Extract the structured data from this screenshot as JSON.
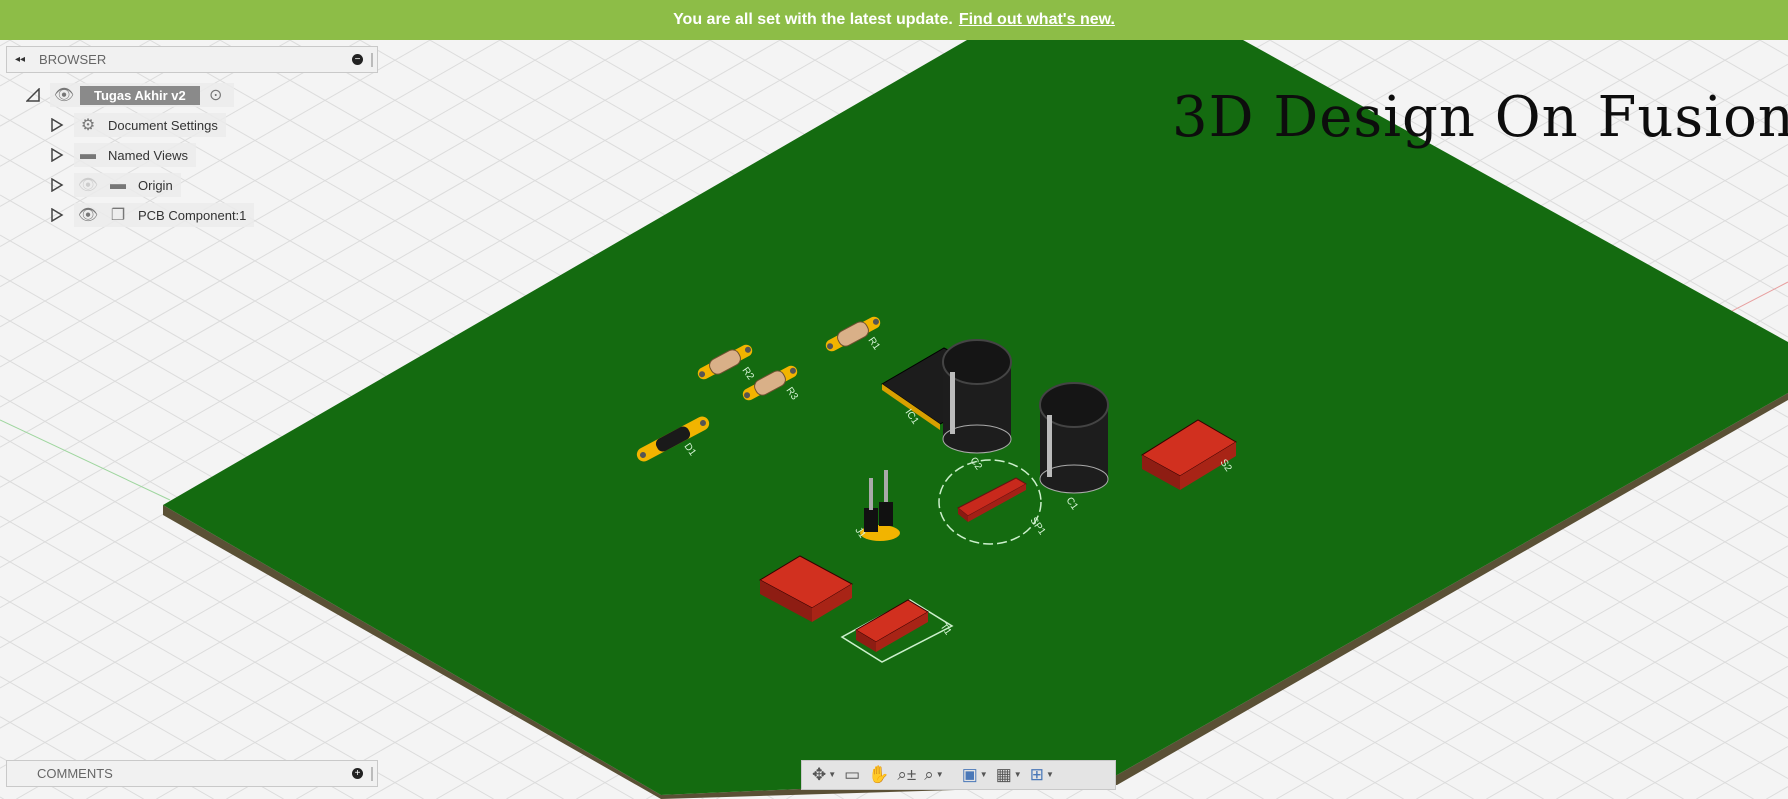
{
  "banner": {
    "message": "You are all set with the latest update.",
    "link": "Find out what's new.",
    "color": "#8dbd47"
  },
  "browser": {
    "title": "BROWSER",
    "root": {
      "label": "Tugas Akhir v2"
    },
    "items": [
      {
        "label": "Document Settings",
        "icon": "gear-icon"
      },
      {
        "label": "Named Views",
        "icon": "folder-icon"
      },
      {
        "label": "Origin",
        "icon": "folder-icon",
        "hidden": true
      },
      {
        "label": "PCB Component:1",
        "icon": "component-icon"
      }
    ]
  },
  "comments": {
    "title": "COMMENTS"
  },
  "overlay_title": "3D Design On Fusion",
  "pcb": {
    "board_color": "#146b10",
    "labels": {
      "r1": "R1",
      "r2": "R2",
      "r3": "R3",
      "d1": "D1",
      "ic1": "IC1",
      "c1": "C1",
      "c2": "C2",
      "sp1": "SP1",
      "s2": "S2",
      "j1": "J1",
      "t1": "T1"
    }
  },
  "navbar": {
    "tools": [
      "orbit-icon",
      "look-at-icon",
      "pan-icon",
      "zoom-icon",
      "fit-icon",
      "display-settings-icon",
      "grid-icon",
      "viewports-icon"
    ]
  }
}
